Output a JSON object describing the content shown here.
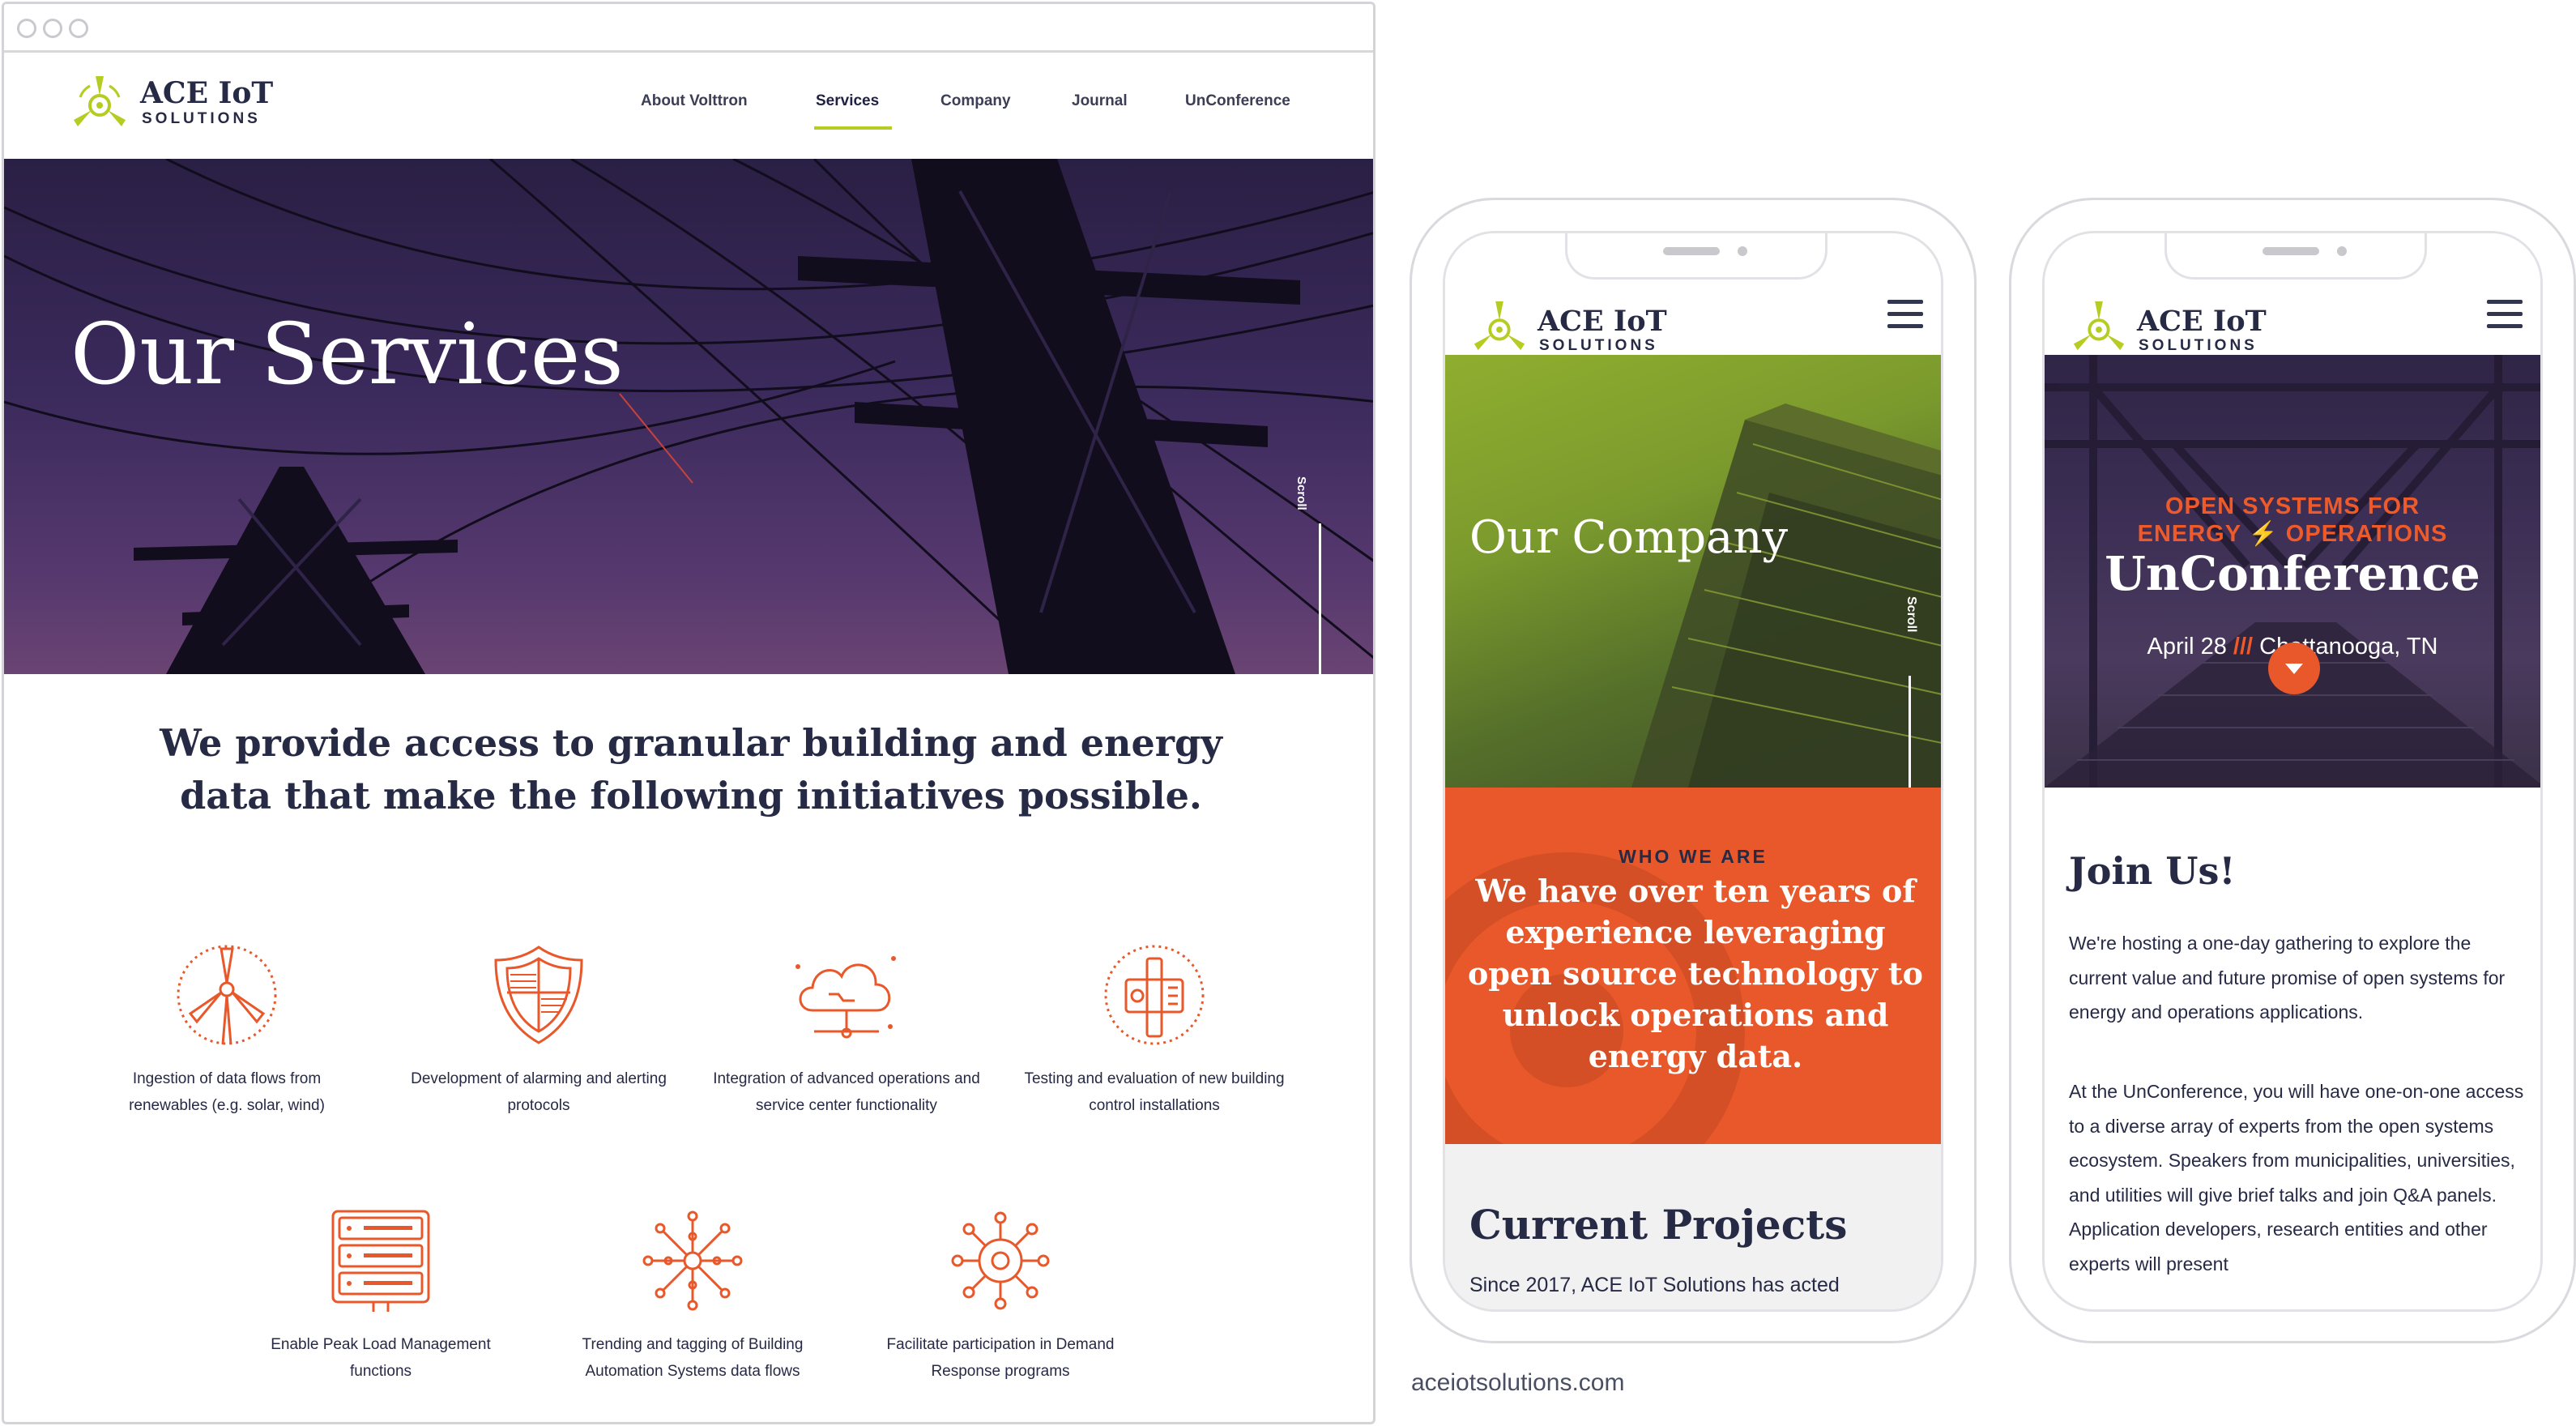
{
  "desktop": {
    "brand": {
      "name": "ACE IoT",
      "tagline": "SOLUTIONS"
    },
    "nav": [
      {
        "label": "About Volttron",
        "active": false
      },
      {
        "label": "Services",
        "active": true
      },
      {
        "label": "Company",
        "active": false
      },
      {
        "label": "Journal",
        "active": false
      },
      {
        "label": "UnConference",
        "active": false
      }
    ],
    "hero": {
      "title": "Our Services",
      "scroll_label": "Scroll"
    },
    "lead": "We provide access to granular building and energy data that make the following initiatives possible.",
    "services": [
      {
        "icon": "wind-turbine-icon",
        "text": "Ingestion of data flows from renewables (e.g. solar, wind)"
      },
      {
        "icon": "shield-icon",
        "text": "Development of alarming and alerting protocols"
      },
      {
        "icon": "cloud-network-icon",
        "text": "Integration of advanced operations and service center functionality"
      },
      {
        "icon": "control-panel-icon",
        "text": "Testing and evaluation of new building control installations"
      },
      {
        "icon": "server-rack-icon",
        "text": "Enable Peak Load Management functions"
      },
      {
        "icon": "network-nodes-icon",
        "text": "Trending and tagging of Building Automation Systems data flows"
      },
      {
        "icon": "gear-network-icon",
        "text": "Facilitate participation in Demand Response programs"
      }
    ]
  },
  "phone_company": {
    "brand": {
      "name": "ACE IoT",
      "tagline": "SOLUTIONS"
    },
    "hero": {
      "title": "Our Company",
      "scroll_label": "Scroll"
    },
    "who": {
      "eyebrow": "WHO WE ARE",
      "body": "We have over ten years of experience leveraging open source technology to unlock operations and energy data."
    },
    "projects": {
      "title": "Current Projects",
      "text": "Since 2017, ACE IoT Solutions has acted"
    }
  },
  "phone_unconference": {
    "brand": {
      "name": "ACE IoT",
      "tagline": "SOLUTIONS"
    },
    "hero": {
      "kicker_line1": "OPEN SYSTEMS FOR",
      "kicker_line2a": "ENERGY",
      "kicker_line2b": "OPERATIONS",
      "title": "UnConference",
      "date": "April 28",
      "separator": "///",
      "location": "Chattanooga, TN"
    },
    "join": {
      "title": "Join Us!",
      "para1": "We're hosting a one-day gathering to explore the current value and future promise of open systems for energy and operations applications.",
      "para2": "At the UnConference, you will have one-on-one access to a diverse array of experts from the open systems ecosystem. Speakers from municipalities, universities, and utilities will give brief talks and join Q&A panels. Application developers, research entities and other experts will present"
    }
  },
  "footer": {
    "url": "aceiotsolutions.com"
  },
  "colors": {
    "navy": "#262a45",
    "orange": "#e8582a",
    "lime": "#b6cc22",
    "purple": "#3b2a5c"
  }
}
